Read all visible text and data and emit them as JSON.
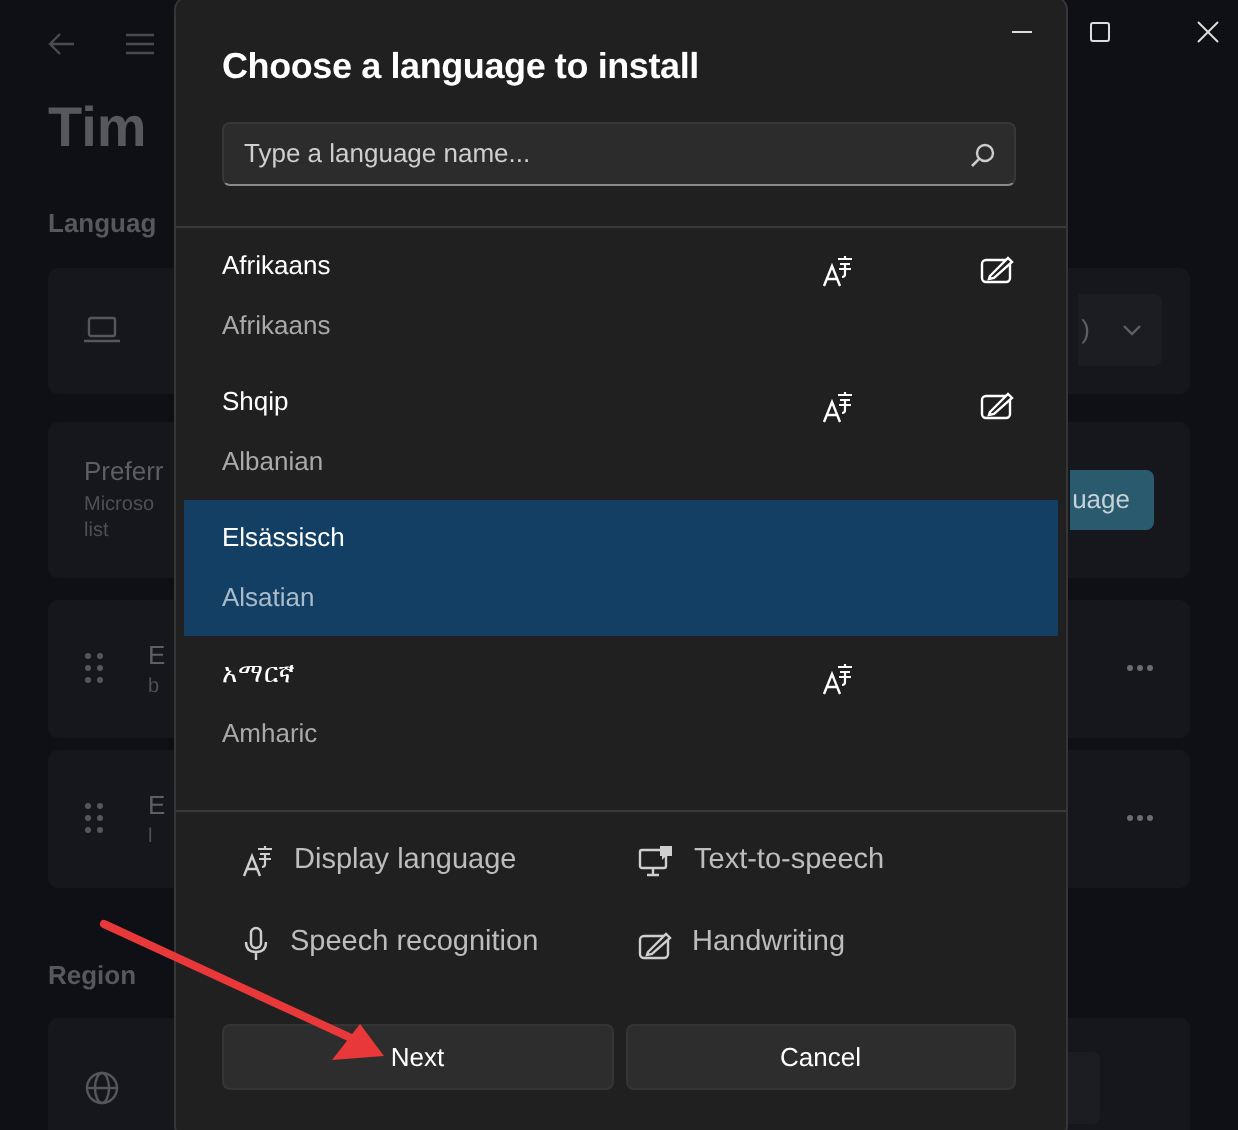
{
  "settings": {
    "page_title": "Tim",
    "section_language": "Languag",
    "display_card": {
      "value": ")"
    },
    "preferred_card": {
      "title": "Preferr",
      "sub": [
        "Microso",
        "list"
      ],
      "button": "uage"
    },
    "language_cards": [
      {
        "title": "E",
        "sub": "b"
      },
      {
        "title": "E",
        "sub": "l"
      }
    ],
    "section_region": "Region"
  },
  "dialog": {
    "title": "Choose a language to install",
    "search": {
      "placeholder": "Type a language name..."
    },
    "languages": [
      {
        "name": "Afrikaans",
        "english": "Afrikaans",
        "display_language": true,
        "handwriting": true,
        "selected": false
      },
      {
        "name": "Shqip",
        "english": "Albanian",
        "display_language": true,
        "handwriting": true,
        "selected": false
      },
      {
        "name": "Elsässisch",
        "english": "Alsatian",
        "display_language": false,
        "handwriting": false,
        "selected": true
      },
      {
        "name": "አማርኛ",
        "english": "Amharic",
        "display_language": true,
        "handwriting": false,
        "selected": false
      }
    ],
    "legend": [
      {
        "kind": "display",
        "label": "Display language"
      },
      {
        "kind": "tts",
        "label": "Text-to-speech"
      },
      {
        "kind": "speech",
        "label": "Speech recognition"
      },
      {
        "kind": "handwriting",
        "label": "Handwriting"
      }
    ],
    "buttons": [
      {
        "label": "Next"
      },
      {
        "label": "Cancel"
      }
    ]
  }
}
